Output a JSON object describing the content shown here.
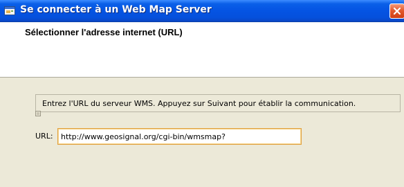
{
  "window": {
    "title": "Se connecter à un Web Map Server"
  },
  "header": {
    "title": "Sélectionner l'adresse internet (URL)"
  },
  "instruction": {
    "text": "Entrez l'URL du serveur WMS. Appuyez sur Suivant pour établir la communication."
  },
  "url_field": {
    "label": "URL:",
    "value": "http://www.geosignal.org/cgi-bin/wmsmap?"
  },
  "icons": {
    "title_icon": "application-window-icon",
    "close_icon": "close-icon",
    "info_icon": "info-bullet-icon"
  },
  "colors": {
    "titlebar": "#0554e3",
    "close_button": "#e35a2e",
    "focused_border": "#e0a040"
  }
}
